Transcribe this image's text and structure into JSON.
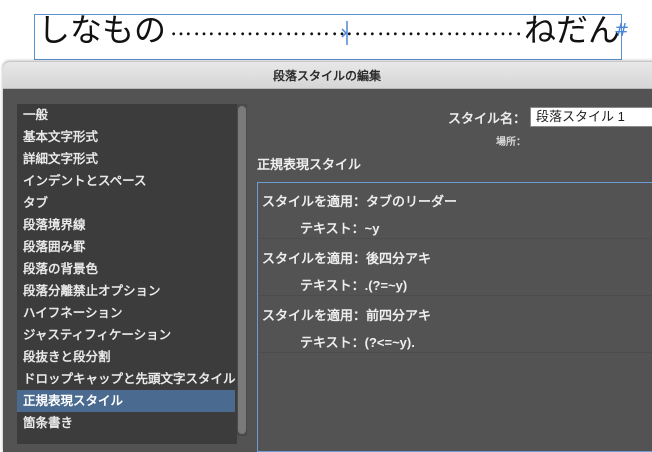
{
  "document": {
    "left_text": "しなもの",
    "leader": "………………………………………………………………………",
    "right_text": "ねだん",
    "pilcrow": "#"
  },
  "dialog": {
    "title": "段落スタイルの編集"
  },
  "sidebar": {
    "items": [
      {
        "label": "一般"
      },
      {
        "label": "基本文字形式"
      },
      {
        "label": "詳細文字形式"
      },
      {
        "label": "インデントとスペース"
      },
      {
        "label": "タブ"
      },
      {
        "label": "段落境界線"
      },
      {
        "label": "段落囲み罫"
      },
      {
        "label": "段落の背景色"
      },
      {
        "label": "段落分離禁止オプション"
      },
      {
        "label": "ハイフネーション"
      },
      {
        "label": "ジャスティフィケーション"
      },
      {
        "label": "段抜きと段分割"
      },
      {
        "label": "ドロップキャップと先頭文字スタイル"
      },
      {
        "label": "正規表現スタイル",
        "selected": true
      },
      {
        "label": "箇条書き"
      }
    ]
  },
  "style_name": {
    "label": "スタイル名：",
    "value": "段落スタイル 1"
  },
  "location": {
    "label": "場所："
  },
  "section": {
    "title": "正規表現スタイル"
  },
  "grep_styles": [
    {
      "apply": "スタイルを適用：タブのリーダー",
      "text": "テキスト：~y"
    },
    {
      "apply": "スタイルを適用：後四分アキ",
      "text": "テキスト：.(?=~y)"
    },
    {
      "apply": "スタイルを適用：前四分アキ",
      "text": "テキスト：(?<=~y)."
    }
  ],
  "colors": {
    "dialog_bg": "#535353",
    "list_bg": "#3c3c3c",
    "selection": "#4a6a90",
    "focus_border": "#6d9bd6"
  }
}
